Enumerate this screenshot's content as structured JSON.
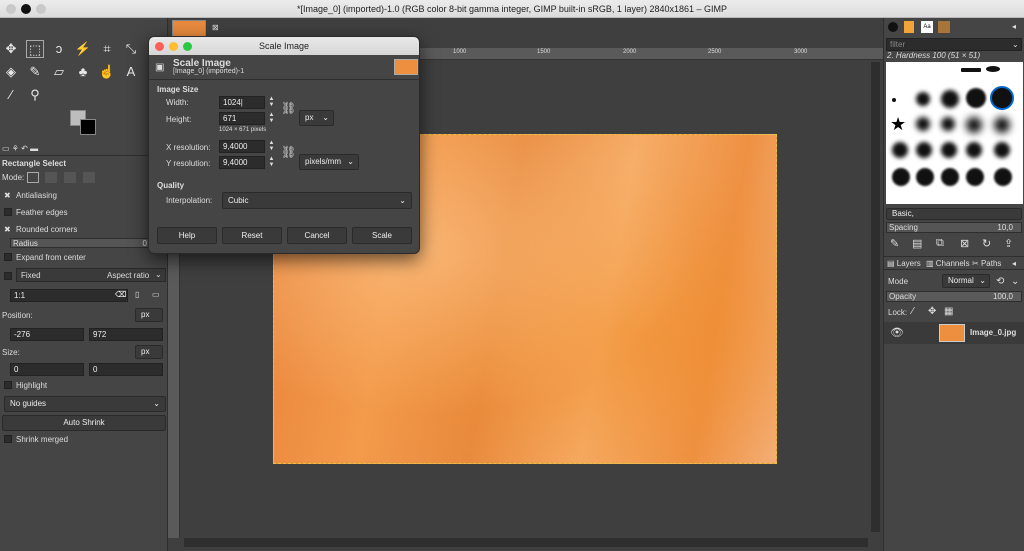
{
  "window": {
    "title": "*[Image_0] (imported)-1.0 (RGB color 8-bit gamma integer, GIMP built-in sRGB, 1 layer) 2840x1861 – GIMP"
  },
  "toolbox": {
    "tool_name": "Rectangle Select",
    "mode_label": "Mode:",
    "antialiasing": "Antialiasing",
    "feather_edges": "Feather edges",
    "rounded_corners": "Rounded corners",
    "radius_label": "Radius",
    "radius_value": "0",
    "expand_from_center": "Expand from center",
    "fixed_label": "Fixed",
    "aspect_ratio": "Aspect ratio",
    "ratio_value": "1:1",
    "position_label": "Position:",
    "position_unit": "px",
    "pos_x": "-276",
    "pos_y": "972",
    "size_label": "Size:",
    "size_unit": "px",
    "size_w": "0",
    "size_h": "0",
    "highlight": "Highlight",
    "guides": "No guides",
    "auto_shrink": "Auto Shrink",
    "shrink_merged": "Shrink merged"
  },
  "rulers": {
    "t1": "1000",
    "t2": "1500",
    "t3": "2000",
    "t4": "2500",
    "t5": "3000"
  },
  "dialog": {
    "window_title": "Scale Image",
    "heading": "Scale Image",
    "subheading": "[Image_0] (imported)-1",
    "image_size": "Image Size",
    "width_label": "Width:",
    "width_value": "1024|",
    "height_label": "Height:",
    "height_value": "671",
    "pixels_info": "1024 × 671 pixels",
    "unit": "px",
    "xres_label": "X resolution:",
    "xres_value": "9,4000",
    "yres_label": "Y resolution:",
    "yres_value": "9,4000",
    "res_unit": "pixels/mm",
    "quality": "Quality",
    "interp_label": "Interpolation:",
    "interp_value": "Cubic",
    "help": "Help",
    "reset": "Reset",
    "cancel": "Cancel",
    "scale": "Scale"
  },
  "dock": {
    "filter_placeholder": "filter",
    "brush_name": "2. Hardness 100 (51 × 51)",
    "brush_set": "Basic,",
    "spacing_label": "Spacing",
    "spacing_value": "10,0",
    "tab_layers": "Layers",
    "tab_channels": "Channels",
    "tab_paths": "Paths",
    "mode_label": "Mode",
    "mode_value": "Normal",
    "opacity_label": "Opacity",
    "opacity_value": "100,0",
    "lock_label": "Lock:",
    "layer_name": "Image_0.jpg"
  },
  "colors": {
    "accent": "#f39a4b",
    "selection": "#e7c23d"
  }
}
